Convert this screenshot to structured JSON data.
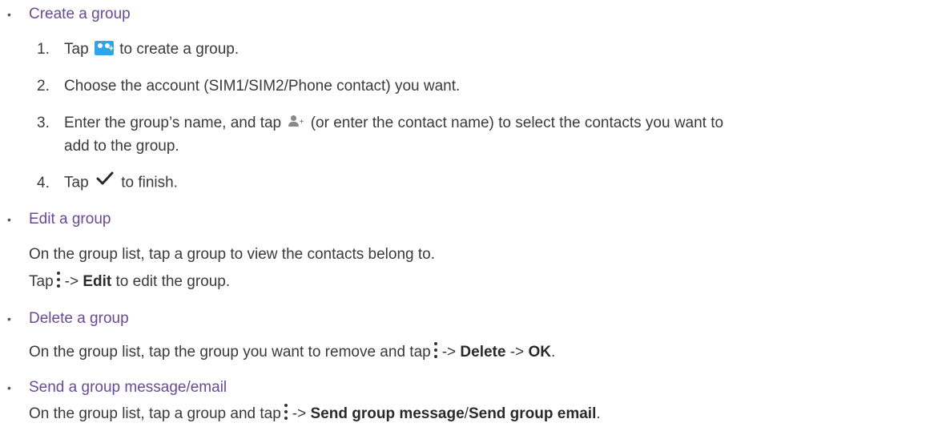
{
  "sections": {
    "create": {
      "title": "Create a group",
      "steps": [
        {
          "num": "1.",
          "before": "Tap",
          "after": "to create a group."
        },
        {
          "num": "2.",
          "text": "Choose the account (SIM1/SIM2/Phone contact) you want."
        },
        {
          "num": "3.",
          "before": "Enter the group’s name, and tap",
          "after": "(or enter the contact name) to select the contacts you want to",
          "cont": "add to the group."
        },
        {
          "num": "4.",
          "before": "Tap",
          "after": "to finish."
        }
      ]
    },
    "edit": {
      "title": "Edit a group",
      "line1": "On the group list, tap a group to view the contacts belong to.",
      "line2_before": "Tap",
      "arrow": "->",
      "bold": "Edit",
      "line2_after": "to edit the group."
    },
    "delete": {
      "title": "Delete a group",
      "before": "On the group list, tap the group you want to remove and tap",
      "arrow1": "->",
      "bold1": "Delete",
      "arrow2": "->",
      "bold2": "OK",
      "end": "."
    },
    "send": {
      "title": "Send a group message/email",
      "before": "On the group list, tap a group and tap",
      "arrow": "->",
      "bold1": "Send group message",
      "slash": "/",
      "bold2": "Send group email",
      "end": "."
    }
  },
  "icons": {
    "create_group": "group-add-icon",
    "add_contact": "person-add-icon",
    "confirm": "checkmark-icon",
    "menu": "more-vert-icon"
  },
  "colors": {
    "heading": "#6a4a96",
    "group_icon": "#2fa4e7",
    "text": "#3a3a3a"
  }
}
